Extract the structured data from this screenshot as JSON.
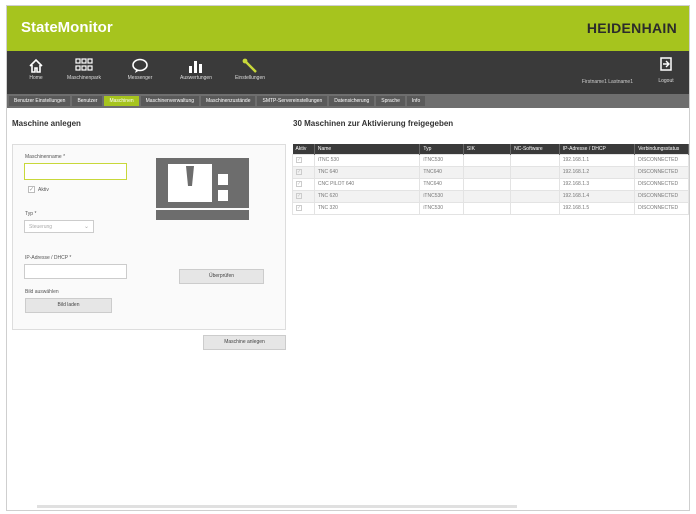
{
  "header": {
    "app_title": "StateMonitor",
    "brand": "HEIDENHAIN",
    "accent": "#a6c41e"
  },
  "nav": {
    "items": [
      {
        "label": "Home",
        "icon": "home-icon"
      },
      {
        "label": "Maschinenpark",
        "icon": "grid-icon"
      },
      {
        "label": "Messenger",
        "icon": "chat-icon"
      },
      {
        "label": "Auswertungen",
        "icon": "bar-chart-icon"
      },
      {
        "label": "Einstellungen",
        "icon": "wrench-icon"
      }
    ],
    "user": "Firstname1 Lastname1",
    "logout": "Logout"
  },
  "tabs": [
    {
      "label": "Benutzer Einstellungen",
      "active": false
    },
    {
      "label": "Benutzer",
      "active": false
    },
    {
      "label": "Maschinen",
      "active": true
    },
    {
      "label": "Maschinenverwaltung",
      "active": false
    },
    {
      "label": "Maschinenzustände",
      "active": false
    },
    {
      "label": "SMTP-Servereinstellungen",
      "active": false
    },
    {
      "label": "Datensicherung",
      "active": false
    },
    {
      "label": "Sprache",
      "active": false
    },
    {
      "label": "Info",
      "active": false
    }
  ],
  "form": {
    "title": "Maschine anlegen",
    "name_label": "Maschinenname *",
    "active_label": "Aktiv",
    "type_label": "Typ *",
    "type_value": "Steuerung",
    "ip_label": "IP-Adresse / DHCP *",
    "check_button": "Überprüfen",
    "image_label": "Bild auswählen",
    "image_button": "Bild laden",
    "submit_button": "Maschine anlegen"
  },
  "machines": {
    "title": "30 Maschinen zur Aktivierung freigegeben",
    "columns": [
      "Aktiv",
      "Name",
      "Typ",
      "SIK",
      "NC-Software",
      "IP-Adresse / DHCP",
      "Verbindungsstatus"
    ],
    "rows": [
      {
        "name": "iTNC 530",
        "type": "iTNC530",
        "sik": "",
        "nc": "",
        "ip": "192.168.1.1",
        "status": "DISCONNECTED"
      },
      {
        "name": "TNC 640",
        "type": "TNC640",
        "sik": "",
        "nc": "",
        "ip": "192.168.1.2",
        "status": "DISCONNECTED"
      },
      {
        "name": "CNC PILOT 640",
        "type": "TNC640",
        "sik": "",
        "nc": "",
        "ip": "192.168.1.3",
        "status": "DISCONNECTED"
      },
      {
        "name": "TNC 620",
        "type": "iTNC530",
        "sik": "",
        "nc": "",
        "ip": "192.168.1.4",
        "status": "DISCONNECTED"
      },
      {
        "name": "TNC 320",
        "type": "iTNC530",
        "sik": "",
        "nc": "",
        "ip": "192.168.1.5",
        "status": "DISCONNECTED"
      }
    ]
  }
}
